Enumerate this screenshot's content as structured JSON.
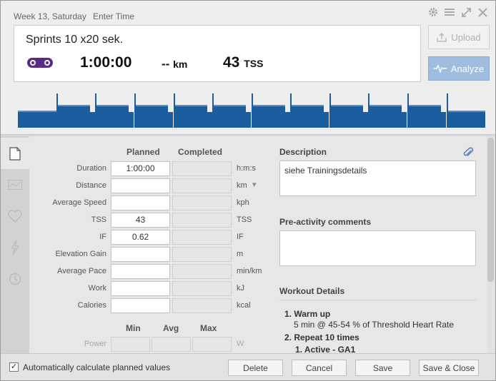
{
  "header": {
    "date": "Week 13, Saturday",
    "enter_time": "Enter Time",
    "icons": [
      "gear-icon",
      "menu-icon",
      "expand-icon",
      "close-icon"
    ]
  },
  "summary": {
    "title": "Sprints 10 x20 sek.",
    "sport_icon": "bike-icon",
    "duration": "1:00:00",
    "distance_value": "--",
    "distance_unit": "km",
    "tss_value": "43",
    "tss_unit": "TSS"
  },
  "actions": {
    "upload": "Upload",
    "analyze": "Analyze"
  },
  "workout_profile": {
    "note": "Workout intensity profile: warmup steps then 10 repeated sprint blocks",
    "colors": {
      "fill": "#1a5ea0",
      "light": "#5a8fc7"
    }
  },
  "rail_tabs": [
    "summary-tab",
    "chart-tab",
    "heart-tab",
    "power-tab",
    "time-tab"
  ],
  "form": {
    "col_planned": "Planned",
    "col_completed": "Completed",
    "rows": [
      {
        "label": "Duration",
        "planned": "1:00:00",
        "completed": "",
        "unit": "h:m:s"
      },
      {
        "label": "Distance",
        "planned": "",
        "completed": "",
        "unit": "km"
      },
      {
        "label": "Average Speed",
        "planned": "",
        "completed": "",
        "unit": "kph"
      },
      {
        "label": "TSS",
        "planned": "43",
        "completed": "",
        "unit": "TSS"
      },
      {
        "label": "IF",
        "planned": "0.62",
        "completed": "",
        "unit": "IF"
      },
      {
        "label": "Elevation Gain",
        "planned": "",
        "completed": "",
        "unit": "m"
      },
      {
        "label": "Average Pace",
        "planned": "",
        "completed": "",
        "unit": "min/km"
      },
      {
        "label": "Work",
        "planned": "",
        "completed": "",
        "unit": "kJ"
      },
      {
        "label": "Calories",
        "planned": "",
        "completed": "",
        "unit": "kcal"
      }
    ],
    "stats_headers": {
      "min": "Min",
      "avg": "Avg",
      "max": "Max"
    },
    "power": {
      "label": "Power",
      "unit": "W"
    }
  },
  "description": {
    "heading": "Description",
    "value": "siehe Trainingsdetails"
  },
  "pre_activity": {
    "heading": "Pre-activity comments",
    "value": ""
  },
  "workout_details": {
    "heading": "Workout Details",
    "line1": "1. Warm up",
    "line1_sub": "5 min @ 45-54 % of Threshold Heart Rate",
    "line2": "2. Repeat 10 times",
    "line3": "1. Active - GA1"
  },
  "footer": {
    "auto_calc": "Automatically calculate planned values",
    "auto_calc_checked": true,
    "delete": "Delete",
    "cancel": "Cancel",
    "save": "Save",
    "save_close": "Save & Close"
  }
}
